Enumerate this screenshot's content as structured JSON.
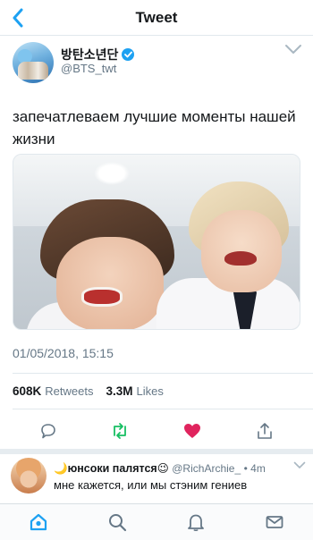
{
  "nav": {
    "title": "Tweet"
  },
  "tweet": {
    "author_name": "방탄소년단",
    "author_handle": "@BTS_twt",
    "text": "запечатлеваем лучшие моменты нашей жизни",
    "timestamp": "01/05/2018, 15:15",
    "stats": {
      "retweets_count": "608K",
      "retweets_label": "Retweets",
      "likes_count": "3.3M",
      "likes_label": "Likes"
    },
    "liked": true
  },
  "reply": {
    "name": "🌙юнсоки палятся😉",
    "handle": "@RichArchie_",
    "time": "• 4m",
    "text": "мне кажется, или мы стэним гениев"
  },
  "colors": {
    "accent": "#1da1f2",
    "retweet": "#17bf63",
    "like": "#e0245e",
    "muted": "#657786",
    "tab_active": "#1da1f2"
  },
  "icons": {
    "back": "chevron-left-icon",
    "verified": "verified-badge-icon",
    "more": "chevron-down-icon",
    "reply": "comment-bubble-icon",
    "retweet": "retweet-icon",
    "like": "heart-icon",
    "share": "share-upload-icon",
    "tabs": [
      "home-icon",
      "search-icon",
      "bell-icon",
      "mail-icon"
    ]
  }
}
